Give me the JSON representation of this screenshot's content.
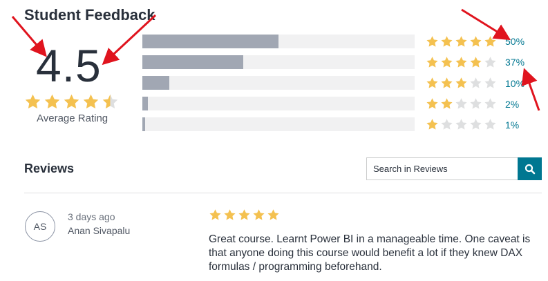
{
  "header": {
    "title": "Student Feedback"
  },
  "summary": {
    "rating": "4.5",
    "stars": 4.5,
    "label": "Average Rating"
  },
  "breakdown": [
    {
      "stars": 5,
      "percent": 50,
      "label": "50%"
    },
    {
      "stars": 4,
      "percent": 37,
      "label": "37%"
    },
    {
      "stars": 3,
      "percent": 10,
      "label": "10%"
    },
    {
      "stars": 2,
      "percent": 2,
      "label": "2%"
    },
    {
      "stars": 1,
      "percent": 1,
      "label": "1%"
    }
  ],
  "reviews": {
    "heading": "Reviews",
    "search_placeholder": "Search in Reviews",
    "search_icon": "magnifier-icon",
    "items": [
      {
        "initials": "AS",
        "date": "3 days ago",
        "name": "Anan Sivapalu",
        "stars": 5,
        "text": "Great course. Learnt Power BI in a manageable time. One caveat is that anyone doing this course would benefit a lot if they knew DAX formulas / programming beforehand."
      }
    ]
  },
  "colors": {
    "star": "#f4c150",
    "star_empty": "#dedfe0",
    "bar_fill": "#a1a7b3",
    "bar_track": "#f1f1f2",
    "accent": "#007791",
    "arrow": "#e0141e"
  }
}
